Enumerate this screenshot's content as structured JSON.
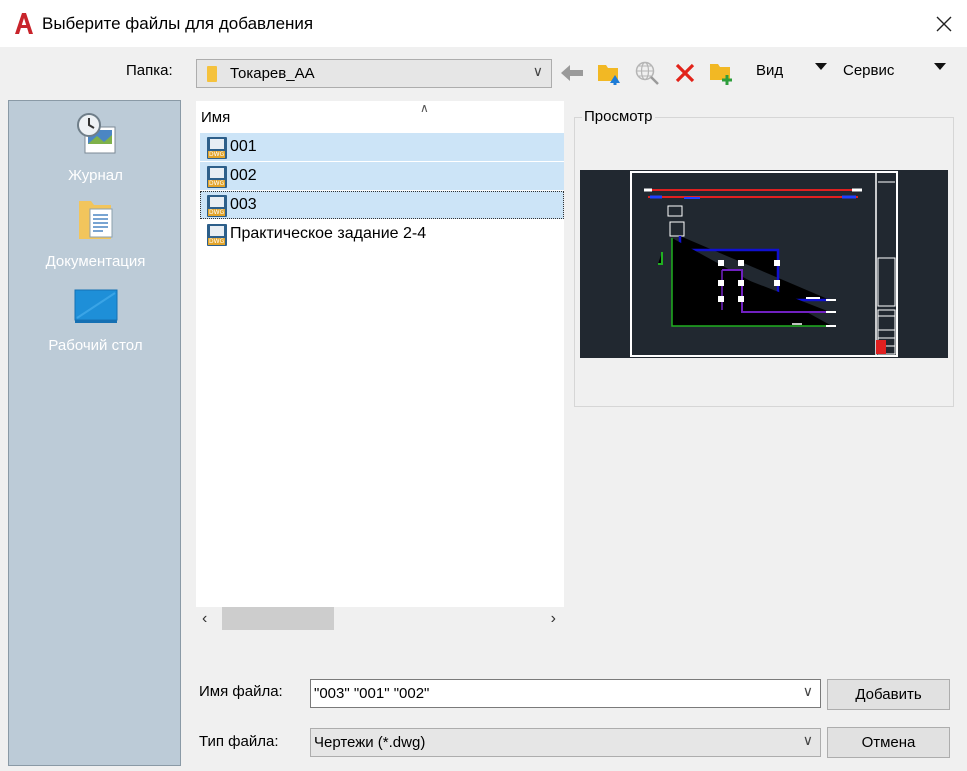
{
  "window": {
    "title": "Выберите файлы для добавления"
  },
  "toolbar": {
    "folder_label": "Папка:",
    "folder_value": "Токарев_АА",
    "view_label": "Вид",
    "tools_label": "Сервис"
  },
  "places": [
    {
      "label": "Журнал",
      "icon": "history-icon"
    },
    {
      "label": "Документация",
      "icon": "documents-icon"
    },
    {
      "label": "Рабочий стол",
      "icon": "desktop-icon"
    }
  ],
  "filelist": {
    "column_name": "Имя",
    "files": [
      {
        "name": "001",
        "selected": true
      },
      {
        "name": "002",
        "selected": true
      },
      {
        "name": "003",
        "selected": true,
        "focused": true
      },
      {
        "name": "Практическое задание 2-4",
        "selected": false
      }
    ]
  },
  "preview": {
    "label": "Просмотр"
  },
  "form": {
    "filename_label": "Имя файла:",
    "filename_value": "\"003\" \"001\" \"002\"",
    "filetype_label": "Тип файла:",
    "filetype_value": "Чертежи (*.dwg)",
    "add_button": "Добавить",
    "cancel_button": "Отмена"
  },
  "colors": {
    "selection": "#cce4f7",
    "places_bg": "#bccbd7",
    "preview_bg": "#212830"
  }
}
